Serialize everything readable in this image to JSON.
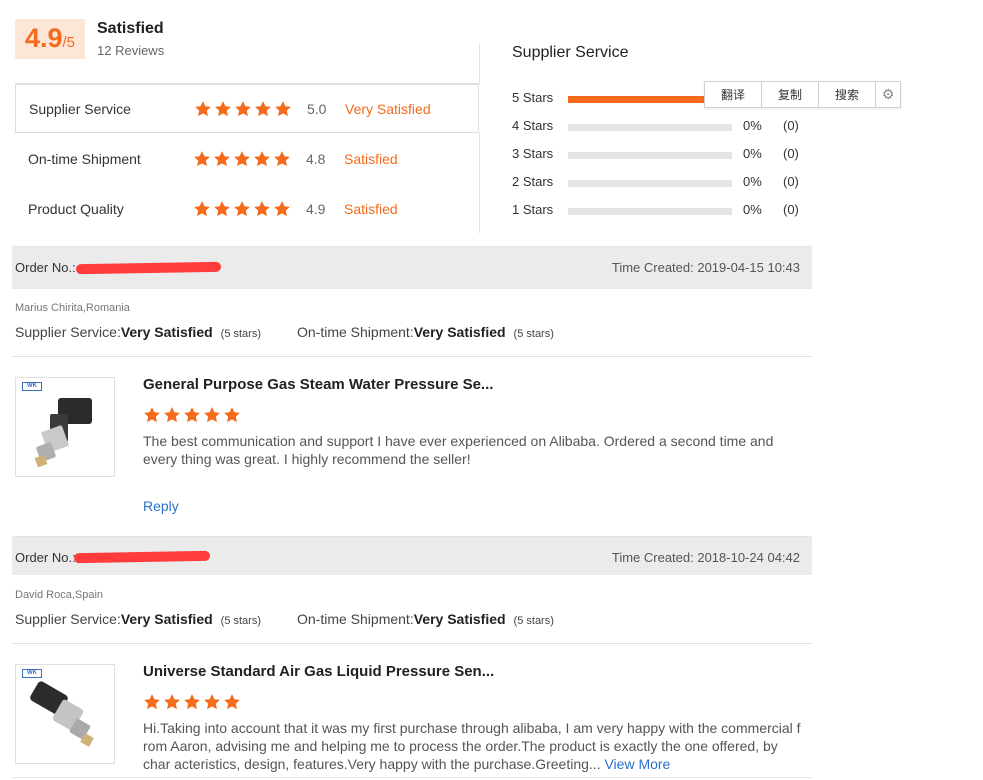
{
  "score": {
    "value": "4.9",
    "out_of": "/5",
    "label": "Satisfied",
    "reviews": "12 Reviews"
  },
  "ratings": [
    {
      "label": "Supplier Service",
      "stars": 5,
      "value": "5.0",
      "text": "Very Satisfied"
    },
    {
      "label": "On-time Shipment",
      "stars": 5,
      "value": "4.8",
      "text": "Satisfied"
    },
    {
      "label": "Product Quality",
      "stars": 5,
      "value": "4.9",
      "text": "Satisfied"
    }
  ],
  "breakdown": {
    "title": "Supplier Service",
    "rows": [
      {
        "label": "5 Stars",
        "fill": 1.0,
        "pct": "",
        "count": ""
      },
      {
        "label": "4 Stars",
        "fill": 0,
        "pct": "0%",
        "count": "(0)"
      },
      {
        "label": "3 Stars",
        "fill": 0,
        "pct": "0%",
        "count": "(0)"
      },
      {
        "label": "2 Stars",
        "fill": 0,
        "pct": "0%",
        "count": "(0)"
      },
      {
        "label": "1 Stars",
        "fill": 0,
        "pct": "0%",
        "count": "(0)"
      }
    ]
  },
  "toolbar": {
    "translate": "翻译",
    "copy": "复制",
    "search": "搜索"
  },
  "orders": [
    {
      "order_label": "Order No.:",
      "time": "Time Created: 2019-04-15 10:43",
      "buyer": "Marius Chirita,Romania",
      "supplier_label": "Supplier Service: ",
      "supplier_value": "Very Satisfied",
      "supplier_stars": "(5 stars)",
      "shipment_label": "On-time Shipment: ",
      "shipment_value": "Very Satisfied",
      "shipment_stars": "(5 stars)",
      "product_title": "General Purpose Gas Steam Water Pressure Se...",
      "review": "The best communication and support I have ever experienced on Alibaba. Ordered a second time and every thing was great. I highly recommend the seller!",
      "reply": "Reply"
    },
    {
      "order_label": "Order No.:",
      "time": "Time Created: 2018-10-24 04:42",
      "buyer": "David Roca,Spain",
      "supplier_label": "Supplier Service: ",
      "supplier_value": "Very Satisfied",
      "supplier_stars": "(5 stars)",
      "shipment_label": "On-time Shipment: ",
      "shipment_value": "Very Satisfied",
      "shipment_stars": "(5 stars)",
      "product_title": "Universe Standard Air Gas Liquid Pressure Sen...",
      "review": "Hi.Taking into account that it was my first purchase through alibaba, I am very happy with the commercial f rom Aaron, advising me and helping me to process the order.The product is exactly the one offered, by char acteristics, design, features.Very happy with the purchase.Greeting...",
      "view_more": "View More"
    }
  ],
  "colors": {
    "accent": "#f46b1b",
    "link": "#2a71c9",
    "order_bar": "#ebebeb"
  }
}
